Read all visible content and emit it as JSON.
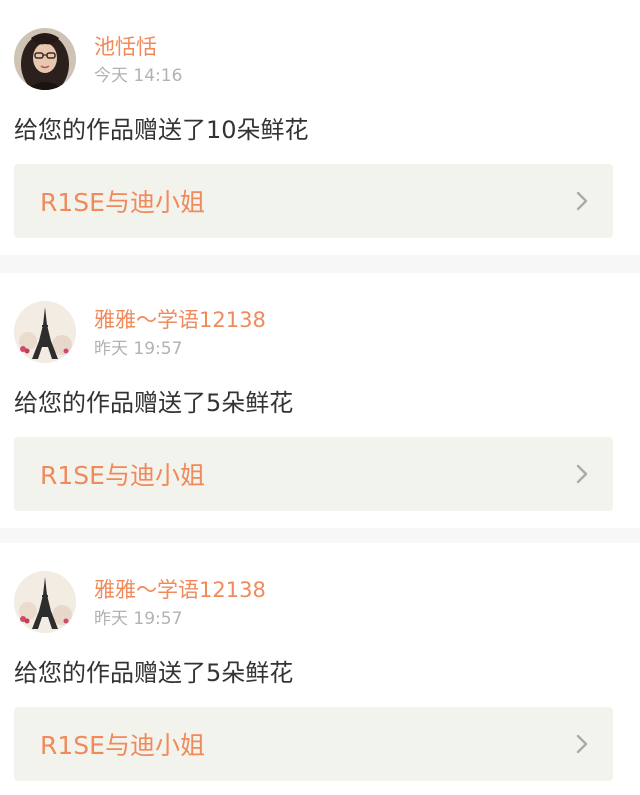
{
  "notifications": [
    {
      "username": "池恬恬",
      "time": "今天 14:16",
      "message": "给您的作品赠送了10朵鲜花",
      "work_title": "R1SE与迪小姐",
      "avatar": "portrait-avatar"
    },
    {
      "username": "雅雅～学语12138",
      "time": "昨天 19:57",
      "message": "给您的作品赠送了5朵鲜花",
      "work_title": "R1SE与迪小姐",
      "avatar": "eiffel-tower-avatar"
    },
    {
      "username": "雅雅～学语12138",
      "time": "昨天 19:57",
      "message": "给您的作品赠送了5朵鲜花",
      "work_title": "R1SE与迪小姐",
      "avatar": "eiffel-tower-avatar"
    }
  ],
  "colors": {
    "accent": "#f08a5b",
    "secondary_text": "#b2b2b2",
    "primary_text": "#333333",
    "link_bg": "#f3f3ed",
    "page_bg": "#f7f7f7"
  }
}
